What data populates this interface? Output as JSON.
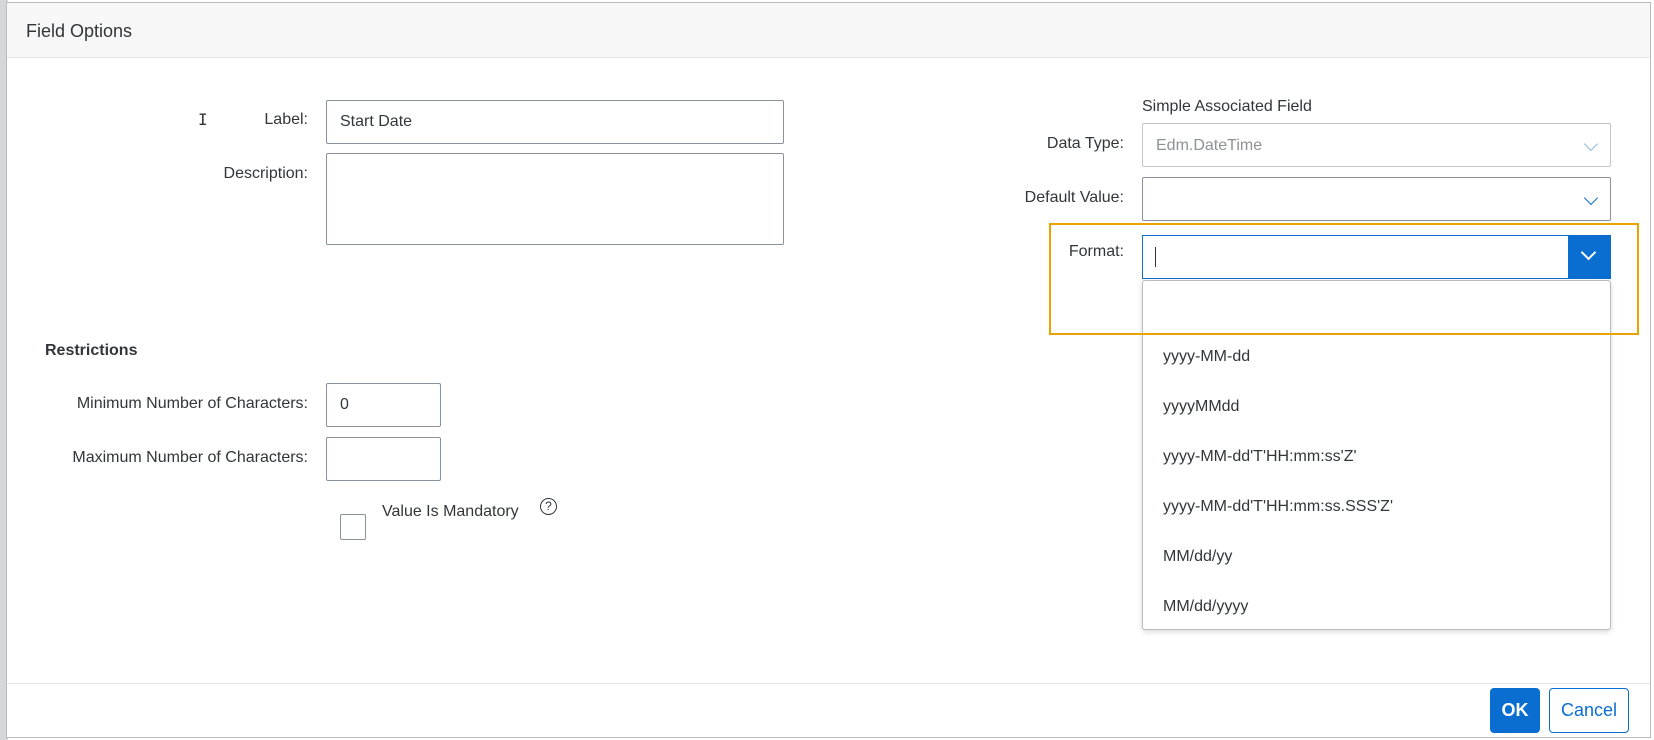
{
  "dialog": {
    "title": "Field Options",
    "cursor_glyph": "I"
  },
  "form": {
    "label": {
      "text": "Label:",
      "value": "Start Date"
    },
    "description": {
      "text": "Description:",
      "value": ""
    }
  },
  "restrictions": {
    "title": "Restrictions",
    "min_chars": {
      "text": "Minimum Number of Characters:",
      "value": "0"
    },
    "max_chars": {
      "text": "Maximum Number of Characters:",
      "value": ""
    },
    "mandatory": {
      "text": "Value Is Mandatory",
      "checked": false
    },
    "help_glyph": "?"
  },
  "associated": {
    "title": "Simple Associated Field",
    "data_type": {
      "text": "Data Type:",
      "value": "Edm.DateTime"
    },
    "default_value": {
      "text": "Default Value:",
      "value": ""
    },
    "format": {
      "text": "Format:",
      "value": "",
      "options": [
        "",
        "yyyy-MM-dd",
        "yyyyMMdd",
        "yyyy-MM-dd'T'HH:mm:ss'Z'",
        "yyyy-MM-dd'T'HH:mm:ss.SSS'Z'",
        "MM/dd/yy",
        "MM/dd/yyyy"
      ]
    }
  },
  "footer": {
    "ok_label": "OK",
    "cancel_label": "Cancel"
  },
  "colors": {
    "accent": "#0a6ed1",
    "highlight": "#e9a400",
    "text": "#32363a"
  }
}
